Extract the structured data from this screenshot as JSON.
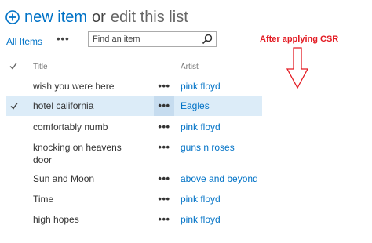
{
  "header": {
    "new_item": "new item",
    "or": "or",
    "edit": "edit this list"
  },
  "view": {
    "all_items": "All Items",
    "ellipsis": "•••"
  },
  "search": {
    "placeholder": "Find an item"
  },
  "annotation": {
    "text": "After applying CSR",
    "color": "#e31b23"
  },
  "columns": {
    "title": "Title",
    "artist": "Artist"
  },
  "rows": [
    {
      "title": "wish you were here",
      "artist": "pink floyd",
      "selected": false
    },
    {
      "title": "hotel california",
      "artist": "Eagles",
      "selected": true
    },
    {
      "title": "comfortably numb",
      "artist": "pink floyd",
      "selected": false
    },
    {
      "title": "knocking on heavens door",
      "artist": "guns n roses",
      "selected": false
    },
    {
      "title": "Sun and Moon",
      "artist": "above and beyond",
      "selected": false
    },
    {
      "title": "Time",
      "artist": "pink floyd",
      "selected": false
    },
    {
      "title": "high hopes",
      "artist": "pink floyd",
      "selected": false
    }
  ],
  "row_menu": "•••",
  "colors": {
    "accent": "#0072c6",
    "selected_row": "#dcecf8"
  }
}
